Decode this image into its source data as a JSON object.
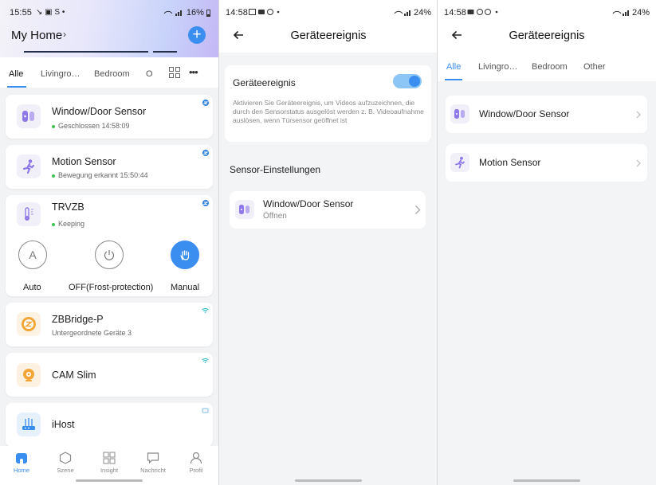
{
  "panel1": {
    "status": {
      "time": "15:55",
      "extras": "↘ ▣ S •",
      "battery": "16%"
    },
    "header": {
      "title": "My Home",
      "chevron": "›",
      "add": "+"
    },
    "tabs": [
      "Alle",
      "Livingro…",
      "Bedroom",
      "O"
    ],
    "more": "•••",
    "devices": [
      {
        "name": "Window/Door Sensor",
        "status": "Geschlossen 14:58:09"
      },
      {
        "name": "Motion Sensor",
        "status": "Bewegung erkannt 15:50:44"
      },
      {
        "name": "TRVZB",
        "status": "Keeping"
      },
      {
        "name": "ZBBridge-P",
        "status": "Untergeordnete Geräte 3"
      },
      {
        "name": "CAM Slim",
        "status": ""
      },
      {
        "name": "iHost",
        "status": ""
      }
    ],
    "modes": [
      {
        "label": "Auto",
        "glyph": "A"
      },
      {
        "label": "OFF(Frost-protection)",
        "glyph": ""
      },
      {
        "label": "Manual",
        "glyph": ""
      }
    ],
    "nav": [
      "Home",
      "Szene",
      "Insight",
      "Nachricht",
      "Profil"
    ]
  },
  "panel2": {
    "status": {
      "time": "14:58",
      "battery": "24%"
    },
    "title": "Geräteereignis",
    "toggle_label": "Geräteereignis",
    "toggle_on": true,
    "description": "Aktivieren Sie Geräteereignis, um Videos aufzuzeichnen, die durch den Sensorstatus ausgelöst werden z. B. Videoaufnahme auslösen, wenn Türsensor geöffnet ist",
    "section": "Sensor-Einstellungen",
    "sensor": {
      "name": "Window/Door Sensor",
      "state": "Öffnen"
    }
  },
  "panel3": {
    "status": {
      "time": "14:58",
      "battery": "24%"
    },
    "title": "Geräteereignis",
    "tabs": [
      "Alle",
      "Livingro…",
      "Bedroom",
      "Other"
    ],
    "items": [
      "Window/Door Sensor",
      "Motion Sensor"
    ]
  },
  "colors": {
    "accent": "#3a8eef",
    "online": "#3cc450"
  }
}
